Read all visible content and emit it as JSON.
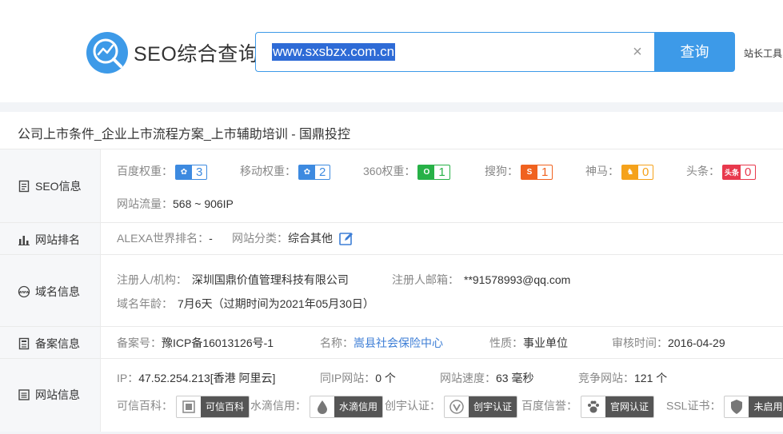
{
  "header": {
    "brand": "SEO综合查询",
    "search_value": "www.sxsbzx.com.cn",
    "search_button": "查询",
    "tool_link": "站长工具"
  },
  "site": {
    "title": "公司上市条件_企业上市流程方案_上市辅助培训 - 国鼎投控"
  },
  "seo": {
    "label": "SEO信息",
    "baidu_key": "百度权重：",
    "baidu_val": "3",
    "mobile_key": "移动权重：",
    "mobile_val": "2",
    "s360_key": "360权重：",
    "s360_val": "1",
    "sogou_key": "搜狗：",
    "sogou_val": "1",
    "shenma_key": "神马：",
    "shenma_val": "0",
    "toutiao_key": "头条：",
    "toutiao_val": "0",
    "toutiao_icon": "头条",
    "traffic_key": "网站流量：",
    "traffic_val": "568 ~ 906IP"
  },
  "rank": {
    "label": "网站排名",
    "alexa_key": "ALEXA世界排名：",
    "alexa_val": "-",
    "category_key": "网站分类：",
    "category_val": "综合其他"
  },
  "domain": {
    "label": "域名信息",
    "registrant_key": "注册人/机构：",
    "registrant_val": "深圳国鼎价值管理科技有限公司",
    "email_key": "注册人邮箱：",
    "email_val": "**91578993@qq.com",
    "age_key": "域名年龄：",
    "age_val": "7月6天（过期时间为2021年05月30日）"
  },
  "icp": {
    "label": "备案信息",
    "number_key": "备案号：",
    "number_val": "豫ICP备16013126号-1",
    "name_key": "名称：",
    "name_val": "嵩县社会保险中心",
    "nature_key": "性质：",
    "nature_val": "事业单位",
    "audit_key": "审核时间：",
    "audit_val": "2016-04-29"
  },
  "siteinfo": {
    "label": "网站信息",
    "ip_key": "IP：",
    "ip_val": "47.52.254.213[香港 阿里云]",
    "sameip_key": "同IP网站：",
    "sameip_val": "0 个",
    "speed_key": "网站速度：",
    "speed_val": "63 毫秒",
    "competitor_key": "竞争网站：",
    "competitor_val": "121 个",
    "kexin_key": "可信百科：",
    "kexin_label": "可信百科",
    "shuidi_key": "水滴信用：",
    "shuidi_label": "水滴信用",
    "chuangyu_key": "创宇认证：",
    "chuangyu_label": "创宇认证",
    "baidu_credit_key": "百度信誉：",
    "baidu_credit_label": "官网认证",
    "ssl_key": "SSL证书：",
    "ssl_label": "未启用"
  },
  "colors": {
    "accent": "#3d9ae8",
    "baidu": "#3d8ae0",
    "s360": "#27b147",
    "sogou": "#f0621f",
    "shenma": "#f5a21b",
    "toutiao": "#e8394d"
  }
}
